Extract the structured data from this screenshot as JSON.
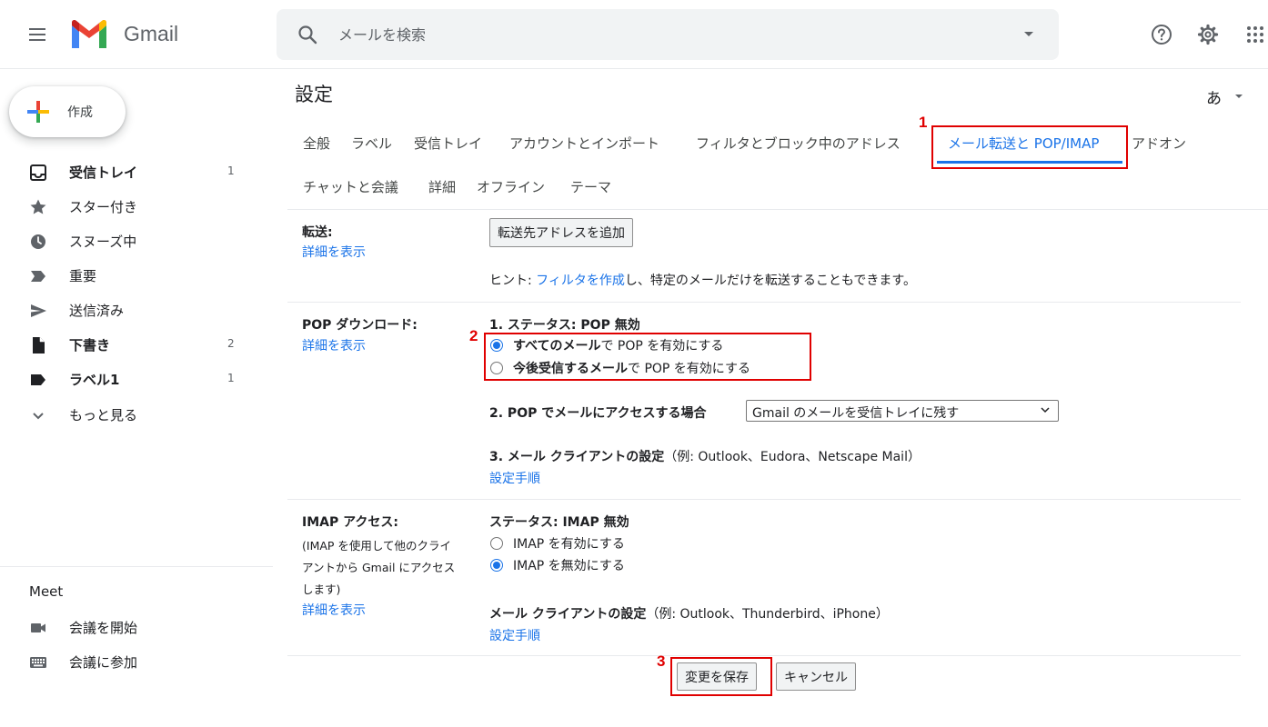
{
  "header": {
    "app_name": "Gmail",
    "search_placeholder": "メールを検索"
  },
  "compose": {
    "label": "作成"
  },
  "sidebar": {
    "items": [
      {
        "label": "受信トレイ",
        "count": "1",
        "bold": true
      },
      {
        "label": "スター付き",
        "count": ""
      },
      {
        "label": "スヌーズ中",
        "count": ""
      },
      {
        "label": "重要",
        "count": ""
      },
      {
        "label": "送信済み",
        "count": ""
      },
      {
        "label": "下書き",
        "count": "2",
        "bold": true
      },
      {
        "label": "ラベル1",
        "count": "1",
        "bold": true
      },
      {
        "label": "もっと見る",
        "count": ""
      }
    ],
    "meet": {
      "title": "Meet",
      "items": [
        {
          "label": "会議を開始"
        },
        {
          "label": "会議に参加"
        }
      ]
    }
  },
  "settings": {
    "title": "設定",
    "lang_button": "あ",
    "tabs": [
      "全般",
      "ラベル",
      "受信トレイ",
      "アカウントとインポート",
      "フィルタとブロック中のアドレス",
      "メール転送と POP/IMAP",
      "アドオン",
      "チャットと会議",
      "詳細",
      "オフライン",
      "テーマ"
    ],
    "forwarding": {
      "label": "転送:",
      "details_link": "詳細を表示",
      "add_button": "転送先アドレスを追加",
      "hint_prefix": "ヒント: ",
      "hint_link": "フィルタを作成",
      "hint_suffix": "し、特定のメールだけを転送することもできます。"
    },
    "pop": {
      "label": "POP ダウンロード:",
      "details_link": "詳細を表示",
      "status": "1. ステータス: POP 無効",
      "option1_bold": "すべてのメール",
      "option1_rest": "で POP を有効にする",
      "option2_bold": "今後受信するメール",
      "option2_rest": "で POP を有効にする",
      "access_label": "2. POP でメールにアクセスする場合",
      "access_selected": "Gmail のメールを受信トレイに残す",
      "client_label": "3. メール クライアントの設定",
      "client_examples": "（例: Outlook、Eudora、Netscape Mail）",
      "setup_link": "設定手順"
    },
    "imap": {
      "label": "IMAP アクセス:",
      "desc_line1": "(IMAP を使用して他のクライ",
      "desc_line2": "アントから Gmail にアクセス",
      "desc_line3": "します)",
      "details_link": "詳細を表示",
      "status": "ステータス: IMAP 無効",
      "option_enable": "IMAP を有効にする",
      "option_disable": "IMAP を無効にする",
      "client_label": "メール クライアントの設定",
      "client_examples": "（例: Outlook、Thunderbird、iPhone）",
      "setup_link": "設定手順"
    },
    "save_button": "変更を保存",
    "cancel_button": "キャンセル"
  },
  "annotations": {
    "step1": "1",
    "step2": "2",
    "step3": "3"
  },
  "colors": {
    "accent": "#1a73e8",
    "annotation": "#e00000"
  }
}
